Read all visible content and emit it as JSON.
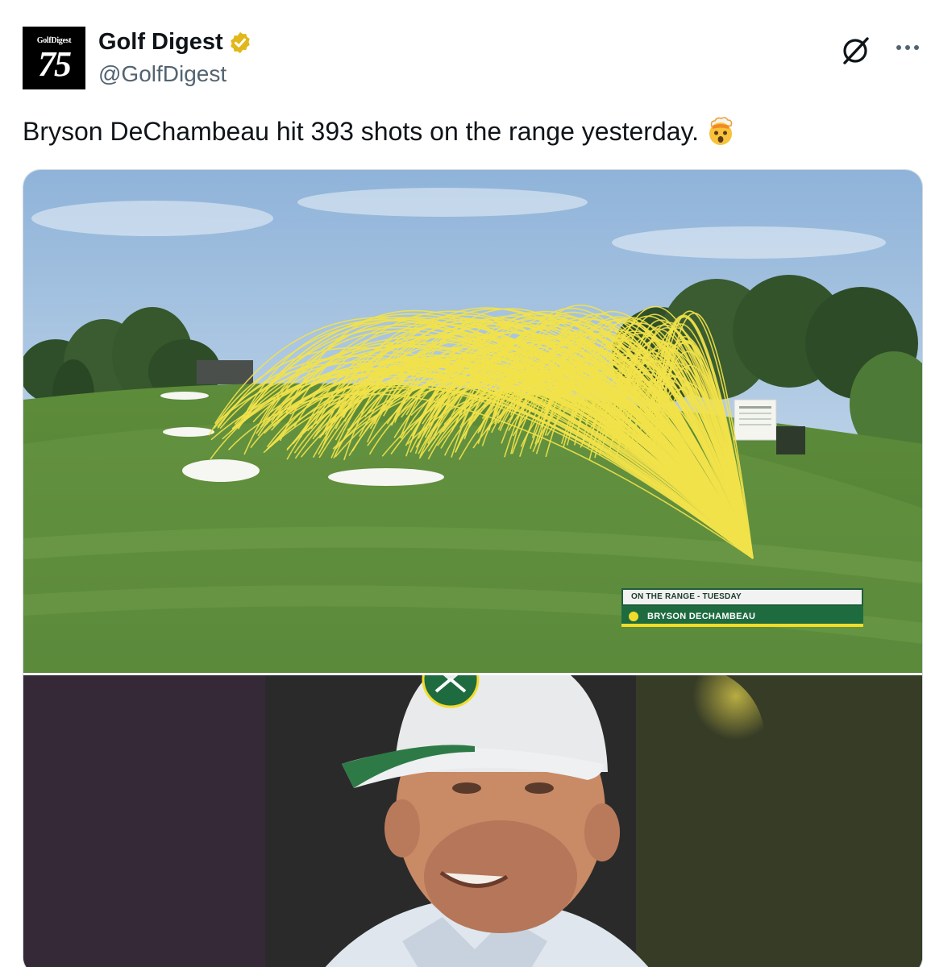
{
  "account": {
    "avatar_brand": "GolfDigest",
    "avatar_number": "75",
    "display_name": "Golf Digest",
    "handle": "@GolfDigest",
    "verified_icon": "gold-verified-badge-icon"
  },
  "actions": {
    "grok_icon": "grok-icon",
    "more_icon": "more-options-icon"
  },
  "tweet": {
    "text": "Bryson DeChambeau hit 393 shots on the range yesterday.",
    "emoji": "exploding-head-emoji"
  },
  "media": {
    "overlay_title": "ON THE RANGE - TUESDAY",
    "overlay_player": "BRYSON DECHAMBEAU",
    "trace_color": "#f2e24a",
    "overlay_green": "#1f6b40",
    "overlay_accent": "#f2dc2a"
  },
  "colors": {
    "text_primary": "#0f1419",
    "text_secondary": "#536471",
    "verified_gold": "#e2b719"
  }
}
